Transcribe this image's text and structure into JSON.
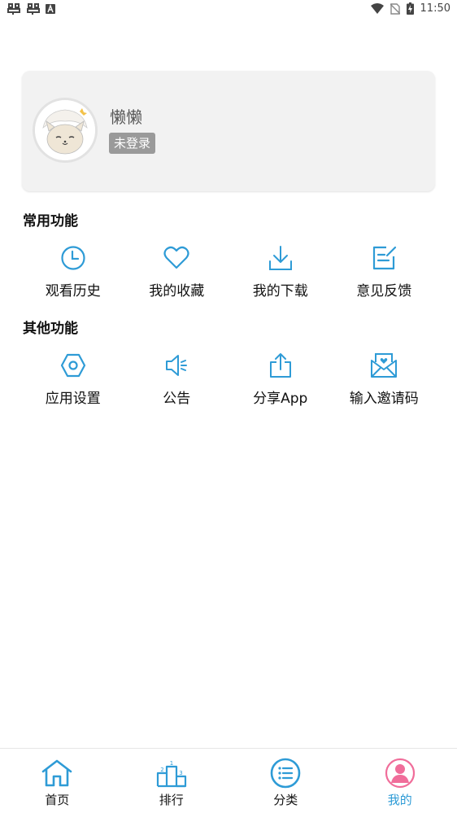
{
  "status_bar": {
    "time": "11:50",
    "left_icons": [
      "bug-icon",
      "bug-icon",
      "notification-a-icon"
    ],
    "right_icons": [
      "wifi-icon",
      "no-sim-icon",
      "battery-charging-icon"
    ]
  },
  "profile": {
    "username": "懒懒",
    "login_status": "未登录",
    "avatar": "cat-avatar-icon"
  },
  "common_section": {
    "title": "常用功能",
    "items": [
      {
        "label": "观看历史",
        "icon": "clock-icon"
      },
      {
        "label": "我的收藏",
        "icon": "heart-icon"
      },
      {
        "label": "我的下载",
        "icon": "download-icon"
      },
      {
        "label": "意见反馈",
        "icon": "edit-icon"
      }
    ]
  },
  "other_section": {
    "title": "其他功能",
    "items": [
      {
        "label": "应用设置",
        "icon": "hexagon-settings-icon"
      },
      {
        "label": "公告",
        "icon": "speaker-icon"
      },
      {
        "label": "分享App",
        "icon": "share-icon"
      },
      {
        "label": "输入邀请码",
        "icon": "envelope-heart-icon"
      }
    ]
  },
  "bottom_nav": {
    "items": [
      {
        "label": "首页",
        "icon": "home-icon",
        "active": false
      },
      {
        "label": "排行",
        "icon": "podium-icon",
        "active": false
      },
      {
        "label": "分类",
        "icon": "category-list-icon",
        "active": false
      },
      {
        "label": "我的",
        "icon": "user-icon",
        "active": true
      }
    ]
  },
  "colors": {
    "accent": "#2e9bd6",
    "active_pink": "#f06d9a",
    "card_bg": "#f2f2f2",
    "badge_bg": "#9a9a9a"
  }
}
